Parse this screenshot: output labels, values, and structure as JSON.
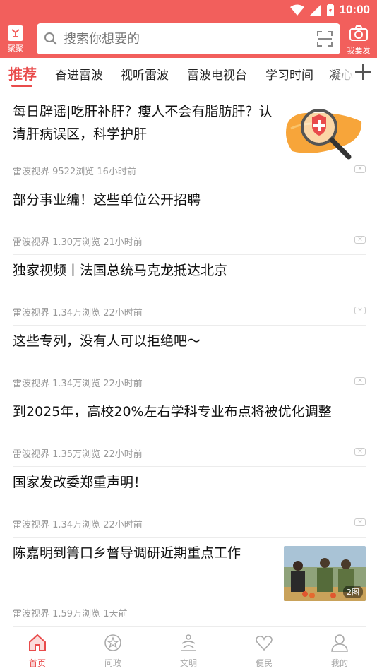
{
  "status": {
    "time": "10:00"
  },
  "header": {
    "logo_label": "聚聚",
    "search_placeholder": "搜索你想要的",
    "camera_label": "我要发"
  },
  "tabs": [
    {
      "label": "推荐",
      "active": true
    },
    {
      "label": "奋进雷波"
    },
    {
      "label": "视听雷波"
    },
    {
      "label": "雷波电视台"
    },
    {
      "label": "学习时间"
    },
    {
      "label": "凝心"
    }
  ],
  "feed": [
    {
      "title": "每日辟谣|吃肝补肝？瘦人不会有脂肪肝？认清肝病误区，科学护肝",
      "meta": "雷波视界 9522浏览 16小时前",
      "thumb": "liver-illustration"
    },
    {
      "title": "部分事业编！这些单位公开招聘",
      "meta": "雷波视界 1.30万浏览 21小时前"
    },
    {
      "title": "独家视频丨法国总统马克龙抵达北京",
      "meta": "雷波视界 1.34万浏览 22小时前"
    },
    {
      "title": "这些专列，没有人可以拒绝吧～",
      "meta": "雷波视界 1.34万浏览 22小时前"
    },
    {
      "title": "到2025年，高校20%左右学科专业布点将被优化调整",
      "meta": "雷波视界 1.35万浏览 22小时前"
    },
    {
      "title": "国家发改委郑重声明！",
      "meta": "雷波视界 1.34万浏览 22小时前"
    },
    {
      "title": "陈嘉明到箐口乡督导调研近期重点工作",
      "meta": "雷波视界 1.59万浏览 1天前",
      "thumb": "officials-photo",
      "image_count": "2图"
    }
  ],
  "dismiss_glyph": "×",
  "bottom_nav": [
    {
      "label": "首页",
      "icon": "home-icon",
      "active": true
    },
    {
      "label": "问政",
      "icon": "star-circle-icon"
    },
    {
      "label": "文明",
      "icon": "civilization-icon"
    },
    {
      "label": "便民",
      "icon": "heart-icon"
    },
    {
      "label": "我的",
      "icon": "user-icon"
    }
  ],
  "colors": {
    "brand_red": "#f25f5c",
    "active_red": "#e94b4b"
  }
}
